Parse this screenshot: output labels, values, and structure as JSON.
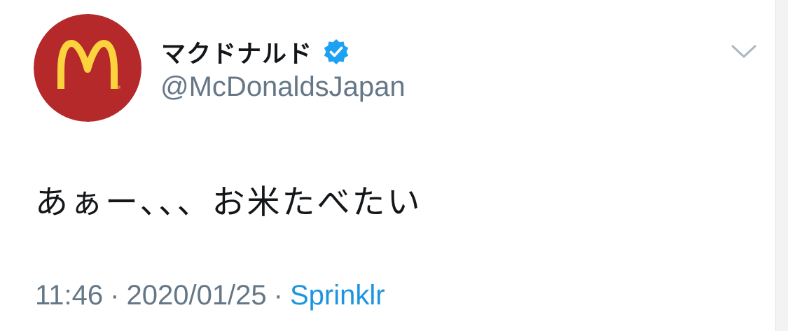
{
  "tweet": {
    "author": {
      "display_name": "マクドナルド",
      "handle": "@McDonaldsJapan",
      "verified": true,
      "avatar_icon": "mcdonalds-logo-icon"
    },
    "text": "あぁー、、、お米たべたい",
    "time": "11:46",
    "separator": "·",
    "date": "2020/01/25",
    "source": "Sprinklr",
    "menu_icon": "chevron-down-icon"
  },
  "colors": {
    "avatar_background": "#b5292a",
    "logo_yellow": "#fcd33d",
    "verified_badge": "#1da1f2",
    "text_primary": "#14171a",
    "text_secondary": "#657786",
    "link": "#1b95e0"
  }
}
